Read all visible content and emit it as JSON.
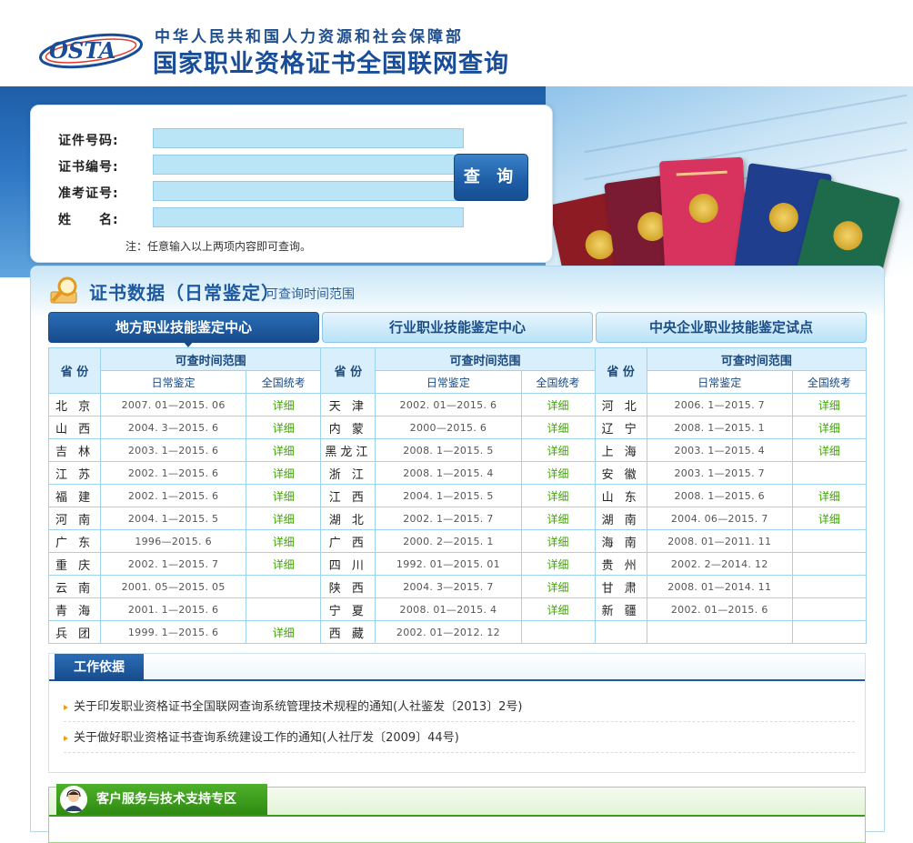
{
  "header": {
    "logo_text": "OSTA",
    "ministry": "中华人民共和国人力资源和社会保障部",
    "title": "国家职业资格证书全国联网查询"
  },
  "search": {
    "fields": [
      {
        "label": "证件号码:",
        "value": ""
      },
      {
        "label": "证书编号:",
        "value": ""
      },
      {
        "label": "准考证号:",
        "value": ""
      },
      {
        "label": "姓　　名:",
        "value": ""
      }
    ],
    "button": "查 询",
    "note": "注：任意输入以上两项内容即可查询。"
  },
  "section": {
    "title": "证书数据（日常鉴定）",
    "subtitle": "可查询时间范围"
  },
  "tabs": [
    {
      "label": "地方职业技能鉴定中心",
      "active": true
    },
    {
      "label": "行业职业技能鉴定中心",
      "active": false
    },
    {
      "label": "中央企业职业技能鉴定试点",
      "active": false
    }
  ],
  "table": {
    "col_province": "省 份",
    "col_range_group": "可查时间范围",
    "col_daily": "日常鉴定",
    "col_national": "全国统考",
    "rows": [
      [
        {
          "p": "北 京",
          "r": "2007. 01—2015. 06",
          "d": "详细"
        },
        {
          "p": "天 津",
          "r": "2002. 01—2015. 6",
          "d": "详细"
        },
        {
          "p": "河 北",
          "r": "2006. 1—2015. 7",
          "d": "详细"
        }
      ],
      [
        {
          "p": "山 西",
          "r": "2004. 3—2015. 6",
          "d": "详细"
        },
        {
          "p": "内 蒙",
          "r": "2000—2015. 6",
          "d": "详细"
        },
        {
          "p": "辽 宁",
          "r": "2008. 1—2015. 1",
          "d": "详细"
        }
      ],
      [
        {
          "p": "吉 林",
          "r": "2003. 1—2015. 6",
          "d": "详细"
        },
        {
          "p": "黑龙江",
          "r": "2008. 1—2015. 5",
          "d": "详细"
        },
        {
          "p": "上 海",
          "r": "2003. 1—2015. 4",
          "d": "详细"
        }
      ],
      [
        {
          "p": "江 苏",
          "r": "2002. 1—2015. 6",
          "d": "详细"
        },
        {
          "p": "浙 江",
          "r": "2008. 1—2015. 4",
          "d": "详细"
        },
        {
          "p": "安 徽",
          "r": "2003. 1—2015. 7",
          "d": ""
        }
      ],
      [
        {
          "p": "福 建",
          "r": "2002. 1—2015. 6",
          "d": "详细"
        },
        {
          "p": "江 西",
          "r": "2004. 1—2015. 5",
          "d": "详细"
        },
        {
          "p": "山 东",
          "r": "2008. 1—2015. 6",
          "d": "详细"
        }
      ],
      [
        {
          "p": "河 南",
          "r": "2004. 1—2015. 5",
          "d": "详细"
        },
        {
          "p": "湖 北",
          "r": "2002. 1—2015. 7",
          "d": "详细"
        },
        {
          "p": "湖 南",
          "r": "2004. 06—2015. 7",
          "d": "详细"
        }
      ],
      [
        {
          "p": "广 东",
          "r": "1996—2015. 6",
          "d": "详细"
        },
        {
          "p": "广 西",
          "r": "2000. 2—2015. 1",
          "d": "详细"
        },
        {
          "p": "海 南",
          "r": "2008. 01—2011. 11",
          "d": ""
        }
      ],
      [
        {
          "p": "重 庆",
          "r": "2002. 1—2015. 7",
          "d": "详细"
        },
        {
          "p": "四 川",
          "r": "1992. 01—2015. 01",
          "d": "详细"
        },
        {
          "p": "贵 州",
          "r": "2002. 2—2014. 12",
          "d": ""
        }
      ],
      [
        {
          "p": "云 南",
          "r": "2001. 05—2015. 05",
          "d": ""
        },
        {
          "p": "陕 西",
          "r": "2004. 3—2015. 7",
          "d": "详细"
        },
        {
          "p": "甘 肃",
          "r": "2008. 01—2014. 11",
          "d": ""
        }
      ],
      [
        {
          "p": "青 海",
          "r": "2001. 1—2015. 6",
          "d": ""
        },
        {
          "p": "宁 夏",
          "r": "2008. 01—2015. 4",
          "d": "详细"
        },
        {
          "p": "新 疆",
          "r": "2002. 01—2015. 6",
          "d": ""
        }
      ],
      [
        {
          "p": "兵 团",
          "r": "1999. 1—2015. 6",
          "d": "详细"
        },
        {
          "p": "西 藏",
          "r": "2002. 01—2012. 12",
          "d": ""
        },
        {
          "p": "",
          "r": "",
          "d": ""
        }
      ]
    ]
  },
  "basis": {
    "title": "工作依据",
    "items": [
      "关于印发职业资格证书全国联网查询系统管理技术规程的通知(人社鉴发〔2013〕2号)",
      "关于做好职业资格证书查询系统建设工作的通知(人社厅发〔2009〕44号)"
    ]
  },
  "service": {
    "title": "客户服务与技术支持专区"
  },
  "colors": {
    "brand_blue": "#1f5aa0",
    "input_bg": "#b9e5f7",
    "detail_green": "#3ea800",
    "service_green": "#3c9a1e"
  }
}
